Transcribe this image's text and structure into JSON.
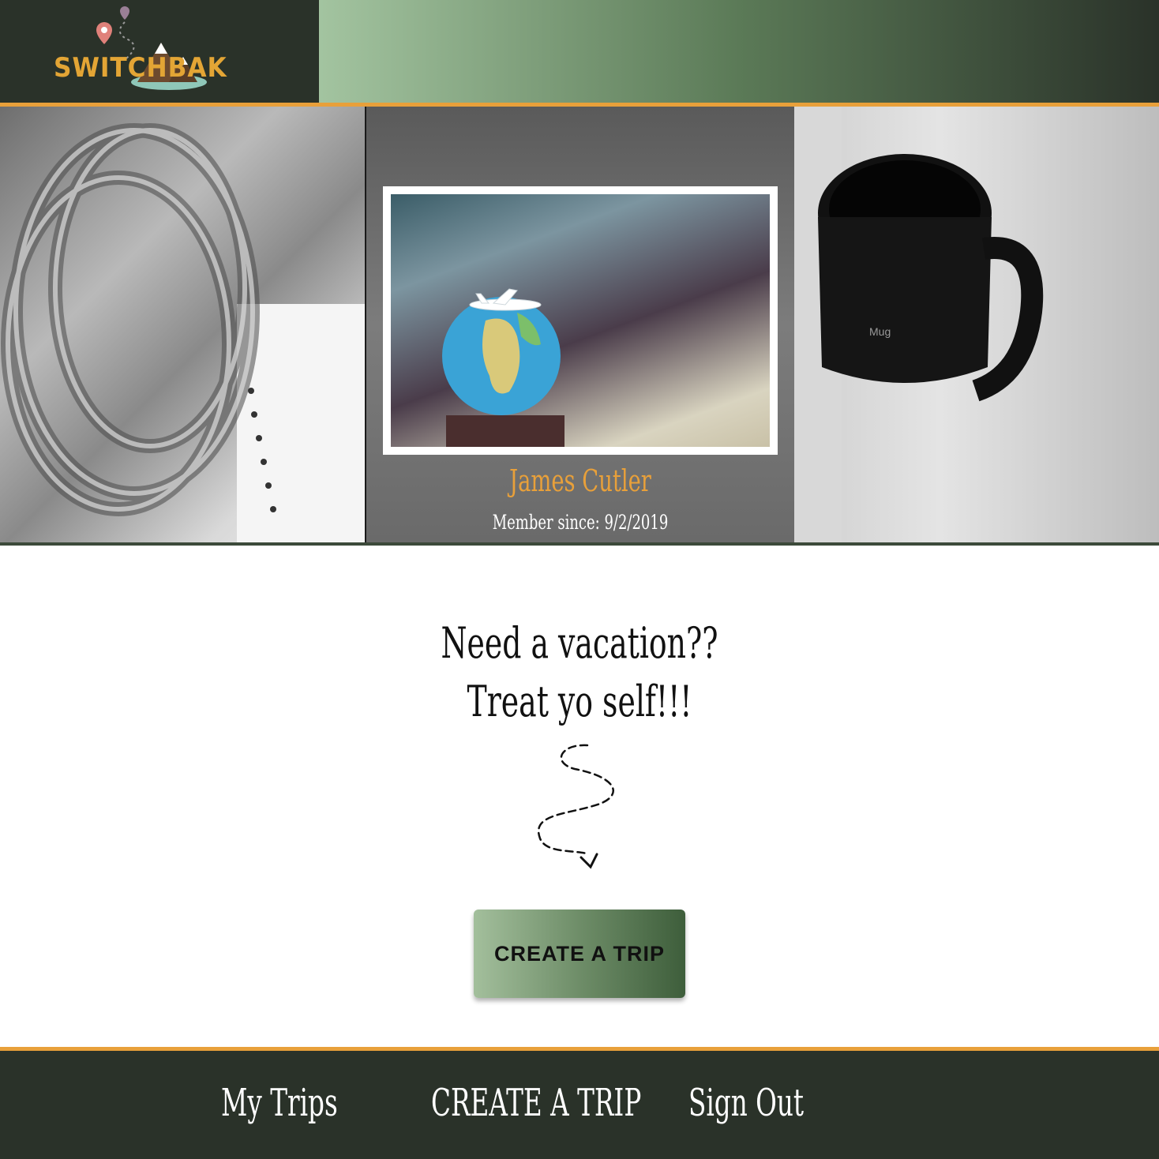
{
  "brand": {
    "logo_text": "SWITCHBAK"
  },
  "colors": {
    "header_dark": "#2a3229",
    "accent_orange": "#e8a03a",
    "gradient_light_green": "#a3c4a0",
    "button_dark_green": "#3e5e3b"
  },
  "profile": {
    "name": "James Cutler",
    "member_since": "Member since: 9/2/2019"
  },
  "main": {
    "tagline_line1": "Need a vacation??",
    "tagline_line2": "Treat yo self!!!",
    "create_button_label": "CREATE A TRIP"
  },
  "footer": {
    "links": [
      {
        "label": "My Trips"
      },
      {
        "label": "CREATE A TRIP"
      },
      {
        "label": "Sign Out"
      }
    ]
  },
  "icons": {
    "logo": "switchbak-logo",
    "map_pin": "map-pin-icon",
    "mountain": "mountain-icon",
    "squiggle": "dashed-arrow-icon"
  }
}
